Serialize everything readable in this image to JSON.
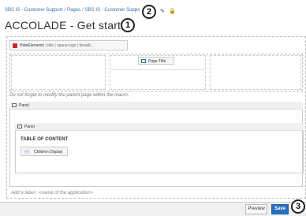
{
  "breadcrumb": {
    "items": [
      "SBS IS - Customer Support",
      "Pages",
      "SBS IS - Customer Suppo"
    ],
    "separator": "/"
  },
  "page": {
    "title": "ACCOLADE - Get started"
  },
  "callouts": {
    "one": "1",
    "two": "2",
    "three": "3"
  },
  "icons": {
    "edit": "pencil-icon",
    "restrict": "lock-icon"
  },
  "macros": {
    "hide_elements": {
      "name": "HideElements",
      "params": " | title | space-logo | breadt..."
    },
    "page_title": "Page Title",
    "panel_outer": "Panel",
    "panel_inner": "Panel",
    "toc": "TABLE OF CONTENT",
    "children": "Children Display"
  },
  "notes": {
    "parent": "Do not forget to modify the parent page within the macro.",
    "label": "Add a label : <name of the application>"
  },
  "footer": {
    "preview_label": "Preview",
    "save_label": "Save"
  },
  "colors": {
    "link": "#3572b0",
    "save": "#2a6fbb"
  }
}
